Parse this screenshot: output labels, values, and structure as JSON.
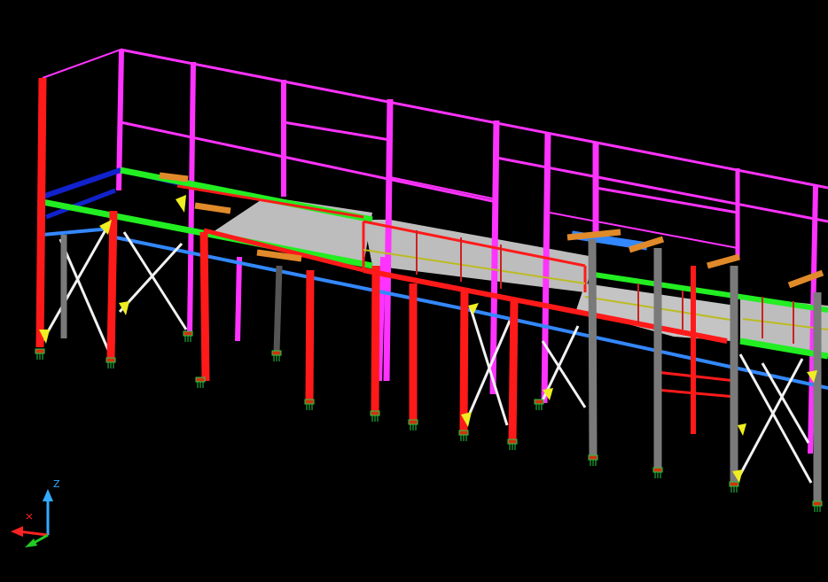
{
  "viewport": {
    "background": "#000000"
  },
  "colors": {
    "column_red": "#FF1A1A",
    "handrail_magenta": "#FF33FF",
    "beam_green": "#22EE22",
    "beam_blue_light": "#3388FF",
    "beam_blue_dark": "#1122CC",
    "deck_grey": "#BDBDBD",
    "brace_white": "#F2F2F2",
    "column_grey": "#7A7A7A",
    "toe_yellow": "#EEEE22",
    "bracket_orange": "#E08A2A",
    "anchor_green": "#22CC44"
  },
  "ucs_icon": {
    "z_label": "Z",
    "x_color": "#FF2222",
    "y_color": "#22CC22",
    "z_color": "#33AAFF"
  }
}
